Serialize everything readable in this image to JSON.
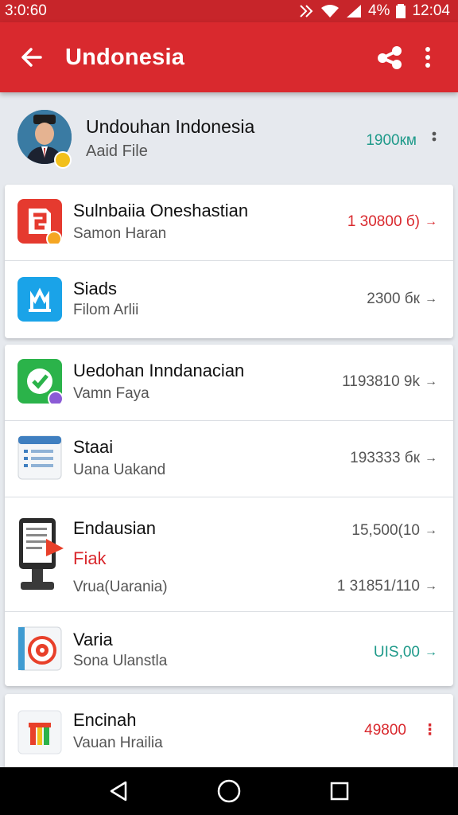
{
  "status_bar": {
    "time": "3:0:60",
    "battery": "4%",
    "clock": "12:04"
  },
  "app_bar": {
    "title": "Undonesia"
  },
  "header": {
    "title": "Undouhan Indonesia",
    "subtitle": "Aaid File",
    "value": "1900км"
  },
  "cards": [
    {
      "rows": [
        {
          "name": "Sulnbaiia Oneshastian",
          "sub": "Samon Haran",
          "value": "1  30800 б)",
          "value_color": "red",
          "icon": "app-red-icon"
        },
        {
          "name": "Siads",
          "sub": "Filom Arlii",
          "value": "2300 бк",
          "value_color": "grey",
          "icon": "app-blue-icon"
        }
      ]
    },
    {
      "rows": [
        {
          "name": "Uedohan Inndanacian",
          "sub": "Vamn Faya",
          "value": "1193810 9k",
          "value_color": "grey",
          "icon": "app-green-icon"
        },
        {
          "name": "Staai",
          "sub": "Uana Uakand",
          "value": "193333 бк",
          "value_color": "grey",
          "icon": "document-list-icon"
        },
        {
          "name": "Endausian",
          "sub2": "Fiak",
          "sub": "Vrua(Uarania)",
          "value": "15,500(10",
          "value2": "1  31851/110",
          "value_color": "grey",
          "icon": "ebook-reader-icon"
        },
        {
          "name": "Varia",
          "sub": "Sona Ulanstla",
          "value": "UIS,00",
          "value_color": "teal",
          "icon": "target-app-icon"
        }
      ]
    },
    {
      "rows": [
        {
          "name": "Encinah",
          "sub": "Vauan Hrailia",
          "value": "49800",
          "value_color": "red",
          "icon": "flag-app-icon"
        }
      ]
    }
  ]
}
